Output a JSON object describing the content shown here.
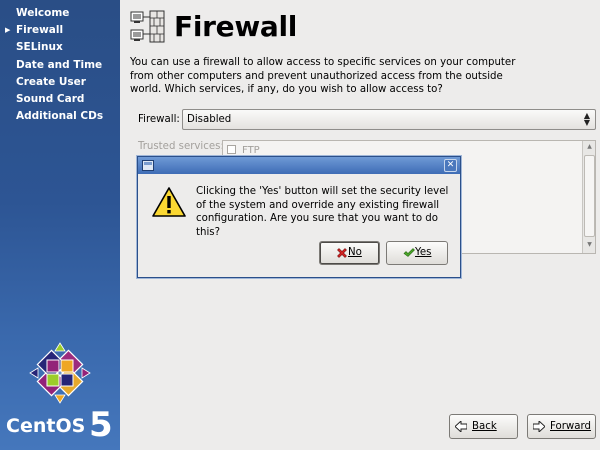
{
  "sidebar": {
    "items": [
      {
        "label": "Welcome",
        "current": false
      },
      {
        "label": "Firewall",
        "current": true
      },
      {
        "label": "SELinux",
        "current": false
      },
      {
        "label": "Date and Time",
        "current": false
      },
      {
        "label": "Create User",
        "current": false
      },
      {
        "label": "Sound Card",
        "current": false
      },
      {
        "label": "Additional CDs",
        "current": false
      }
    ],
    "logo_text": "CentOS",
    "logo_version": "5"
  },
  "page": {
    "title": "Firewall",
    "description": "You can use a firewall to allow access to specific services on your computer from other computers and prevent unauthorized access from the outside world.  Which services, if any, do you wish to allow access to?",
    "firewall_label": "Firewall:",
    "firewall_value": "Disabled",
    "trusted_label": "Trusted services:",
    "services": [
      {
        "label": "FTP",
        "checked": false
      }
    ]
  },
  "nav": {
    "back_label": "Back",
    "forward_label": "Forward"
  },
  "dialog": {
    "message": "Clicking the 'Yes' button will set the security level of the system and override any existing firewall configuration.  Are you sure that you want to do this?",
    "no_label": "No",
    "yes_label": "Yes"
  },
  "colors": {
    "sidebar_blue": "#2d5594",
    "dialog_titlebar": "#3e6cb5",
    "window_bg": "#edeceb"
  }
}
